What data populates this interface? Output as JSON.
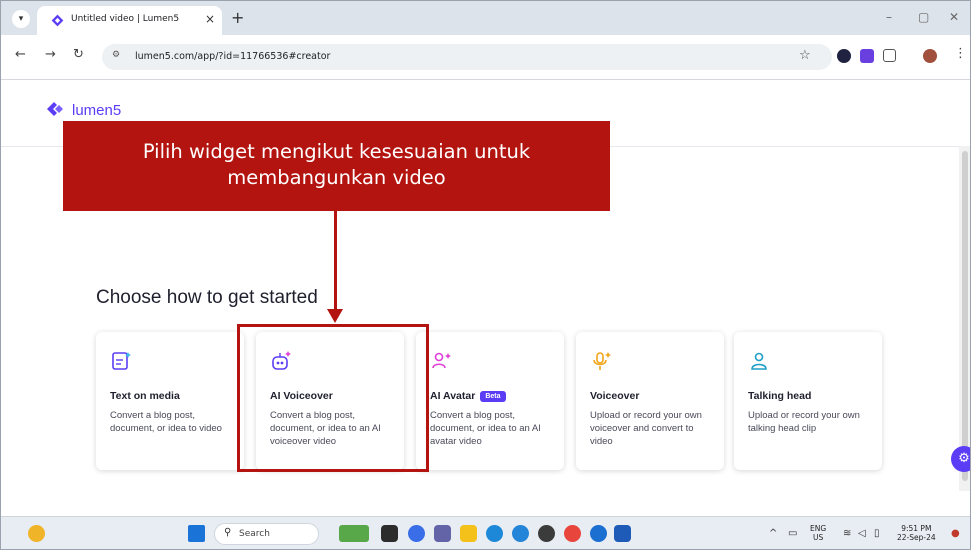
{
  "browser": {
    "tab_title": "Untitled video | Lumen5",
    "tab_close": "×",
    "new_tab": "+",
    "url": "lumen5.com/app/?id=11766536#creator",
    "minimize": "–",
    "maximize": "▢",
    "close": "✕"
  },
  "app": {
    "logo_text": "lumen5",
    "accent_color": "#5b3df5"
  },
  "callout": {
    "text": "Pilih widget mengikut kesesuaian untuk membangunkan video",
    "color": "#b3140f"
  },
  "main": {
    "heading": "Choose how to get started",
    "cards": [
      {
        "title": "Text on media",
        "description": "Convert a blog post, document, or idea to video",
        "icon": "text-media-icon"
      },
      {
        "title": "AI Voiceover",
        "description": "Convert a blog post, document, or idea to an AI voiceover video",
        "icon": "robot-icon"
      },
      {
        "title": "AI Avatar",
        "badge": "Beta",
        "description": "Convert a blog post, document, or idea to an AI avatar video",
        "icon": "avatar-sparkle-icon"
      },
      {
        "title": "Voiceover",
        "description": "Upload or record your own voiceover and convert to video",
        "icon": "microphone-icon"
      },
      {
        "title": "Talking head",
        "description": "Upload or record your own talking head clip",
        "icon": "person-icon"
      }
    ]
  },
  "taskbar": {
    "search_placeholder": "Search",
    "lang_top": "ENG",
    "lang_bottom": "US",
    "time": "9:51 PM",
    "date": "22-Sep-24"
  }
}
